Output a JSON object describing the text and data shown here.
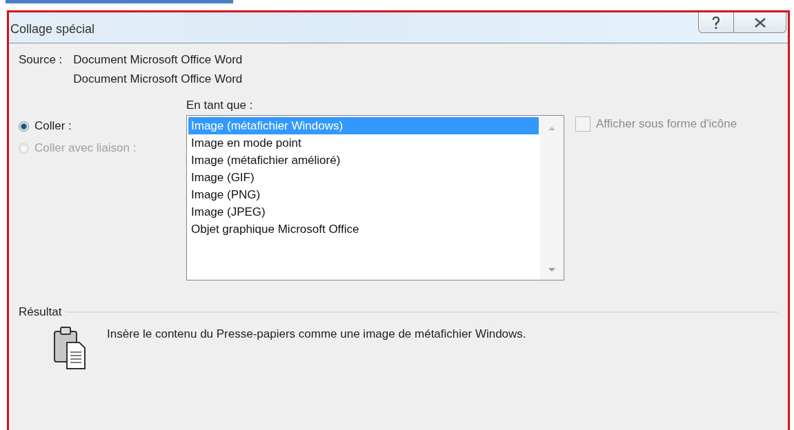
{
  "window": {
    "title": "Collage spécial"
  },
  "source": {
    "label": "Source :",
    "lines": [
      "Document Microsoft Office Word",
      "Document Microsoft Office Word"
    ]
  },
  "list_label": "En tant que :",
  "options": [
    {
      "label": "Coller :",
      "selected": true,
      "disabled": false
    },
    {
      "label": "Coller avec liaison :",
      "selected": false,
      "disabled": true
    }
  ],
  "formats": [
    {
      "label": "Image (métafichier Windows)",
      "selected": true
    },
    {
      "label": "Image en mode point",
      "selected": false
    },
    {
      "label": "Image (métafichier amélioré)",
      "selected": false
    },
    {
      "label": "Image (GIF)",
      "selected": false
    },
    {
      "label": "Image (PNG)",
      "selected": false
    },
    {
      "label": "Image (JPEG)",
      "selected": false
    },
    {
      "label": "Objet graphique Microsoft Office",
      "selected": false
    }
  ],
  "display_as_icon": {
    "label": "Afficher sous forme d'icône",
    "checked": false,
    "disabled": true
  },
  "result": {
    "title": "Résultat",
    "text": "Insère le contenu du Presse-papiers comme une image de métafichier Windows."
  }
}
